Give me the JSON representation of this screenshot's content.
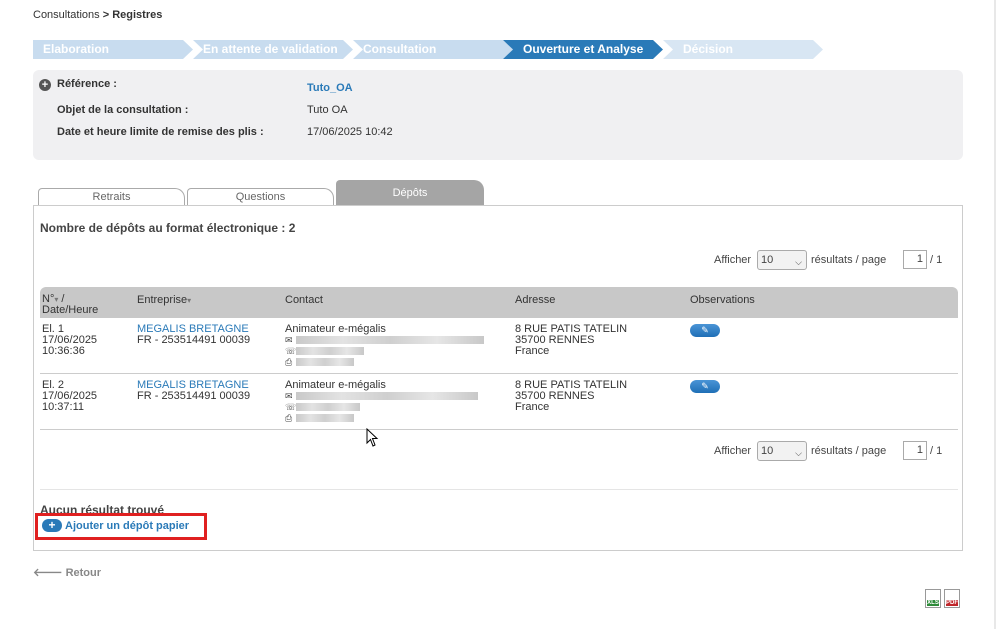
{
  "breadcrumb": {
    "parent": "Consultations",
    "separator": ">",
    "current": "Registres"
  },
  "steps": [
    {
      "label": "Elaboration",
      "state": "done"
    },
    {
      "label": "En attente de validation",
      "state": "done"
    },
    {
      "label": "Consultation",
      "state": "done"
    },
    {
      "label": "Ouverture et Analyse",
      "state": "active"
    },
    {
      "label": "Décision",
      "state": "todo"
    }
  ],
  "reference": {
    "ref_label": "Référence :",
    "ref_value": "Tuto_OA",
    "objet_label": "Objet de la consultation :",
    "objet_value": "Tuto OA",
    "date_label": "Date et heure limite de remise des plis :",
    "date_value": "17/06/2025 10:42"
  },
  "tabs": [
    {
      "label": "Retraits",
      "active": false
    },
    {
      "label": "Questions",
      "active": false
    },
    {
      "label": "Dépôts",
      "active": true
    }
  ],
  "depots": {
    "count_text": "Nombre de dépôts au format électronique : 2",
    "pager": {
      "show_label": "Afficher",
      "per_page_value": "10",
      "results_label": "résultats / page",
      "page_value": "1",
      "page_total": "/ 1"
    },
    "columns": {
      "num": "N°",
      "num_sep": "/",
      "date": "Date/Heure",
      "entreprise": "Entreprise",
      "contact": "Contact",
      "adresse": "Adresse",
      "observations": "Observations"
    },
    "rows": [
      {
        "num": "El. 1",
        "date": "17/06/2025",
        "time": "10:36:36",
        "company": "MEGALIS BRETAGNE",
        "siret": "FR - 253514491 00039",
        "contact": "Animateur e-mégalis",
        "addr1": "8 RUE PATIS TATELIN",
        "addr2": "35700 RENNES",
        "addr3": "France"
      },
      {
        "num": "El. 2",
        "date": "17/06/2025",
        "time": "10:37:11",
        "company": "MEGALIS BRETAGNE",
        "siret": "FR - 253514491 00039",
        "contact": "Animateur e-mégalis",
        "addr1": "8 RUE PATIS TATELIN",
        "addr2": "35700 RENNES",
        "addr3": "France"
      }
    ],
    "no_result": "Aucun résultat trouvé",
    "add_paper_label": "Ajouter un dépôt papier"
  },
  "retour_label": "Retour",
  "export": {
    "xls_label": "XLS",
    "pdf_label": "PDF"
  },
  "colors": {
    "step_done": "#c8dcef",
    "step_active": "#2a7ab8",
    "link": "#2a7ab8",
    "highlight": "#e02020",
    "table_header": "#c8c8c8"
  }
}
